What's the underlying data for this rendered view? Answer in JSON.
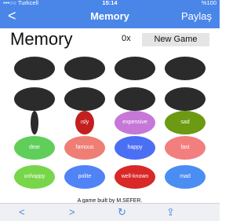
{
  "status": {
    "carrier": "•••○○ Turkcell",
    "time": "15:14",
    "battery": "%100"
  },
  "nav": {
    "back": "<",
    "title": "Memory",
    "share": "Paylaş"
  },
  "game": {
    "title": "Memory",
    "score": "0x",
    "new_game": "New Game"
  },
  "cards": [
    {
      "label": "",
      "color": "#2b2b2b",
      "row": 0,
      "col": 0
    },
    {
      "label": "",
      "color": "#2b2b2b",
      "row": 0,
      "col": 1
    },
    {
      "label": "",
      "color": "#2b2b2b",
      "row": 0,
      "col": 2
    },
    {
      "label": "",
      "color": "#2b2b2b",
      "row": 0,
      "col": 3
    },
    {
      "label": "",
      "color": "#2b2b2b",
      "row": 1,
      "col": 0
    },
    {
      "label": "",
      "color": "#2b2b2b",
      "row": 1,
      "col": 1
    },
    {
      "label": "",
      "color": "#2b2b2b",
      "row": 1,
      "col": 2
    },
    {
      "label": "",
      "color": "#2b2b2b",
      "row": 1,
      "col": 3
    },
    {
      "label": "",
      "color": "#2b2b2b",
      "row": 2,
      "col": 0
    },
    {
      "label": "ısly",
      "color": "#c41f1f",
      "row": 2,
      "col": 1
    },
    {
      "label": "expensive",
      "color": "#c678d8",
      "row": 2,
      "col": 2
    },
    {
      "label": "sad",
      "color": "#6c9a12",
      "row": 2,
      "col": 3
    },
    {
      "label": "dear",
      "color": "#5fcf5a",
      "row": 3,
      "col": 0
    },
    {
      "label": "famous",
      "color": "#ef7f75",
      "row": 3,
      "col": 1
    },
    {
      "label": "happy",
      "color": "#4b6ff4",
      "row": 3,
      "col": 2
    },
    {
      "label": "fast",
      "color": "#f37e7e",
      "row": 3,
      "col": 3
    },
    {
      "label": "unhappy",
      "color": "#78d64a",
      "row": 4,
      "col": 0
    },
    {
      "label": "polite",
      "color": "#4f83f6",
      "row": 4,
      "col": 1
    },
    {
      "label": "well-known",
      "color": "#d82828",
      "row": 4,
      "col": 2
    },
    {
      "label": "mad",
      "color": "#4a8ef3",
      "row": 4,
      "col": 3
    }
  ],
  "footer": {
    "text": "A game built by M.SEFER."
  },
  "toolbar": {
    "back": "<",
    "forward": ">",
    "refresh": "↻",
    "share": "⇪"
  }
}
